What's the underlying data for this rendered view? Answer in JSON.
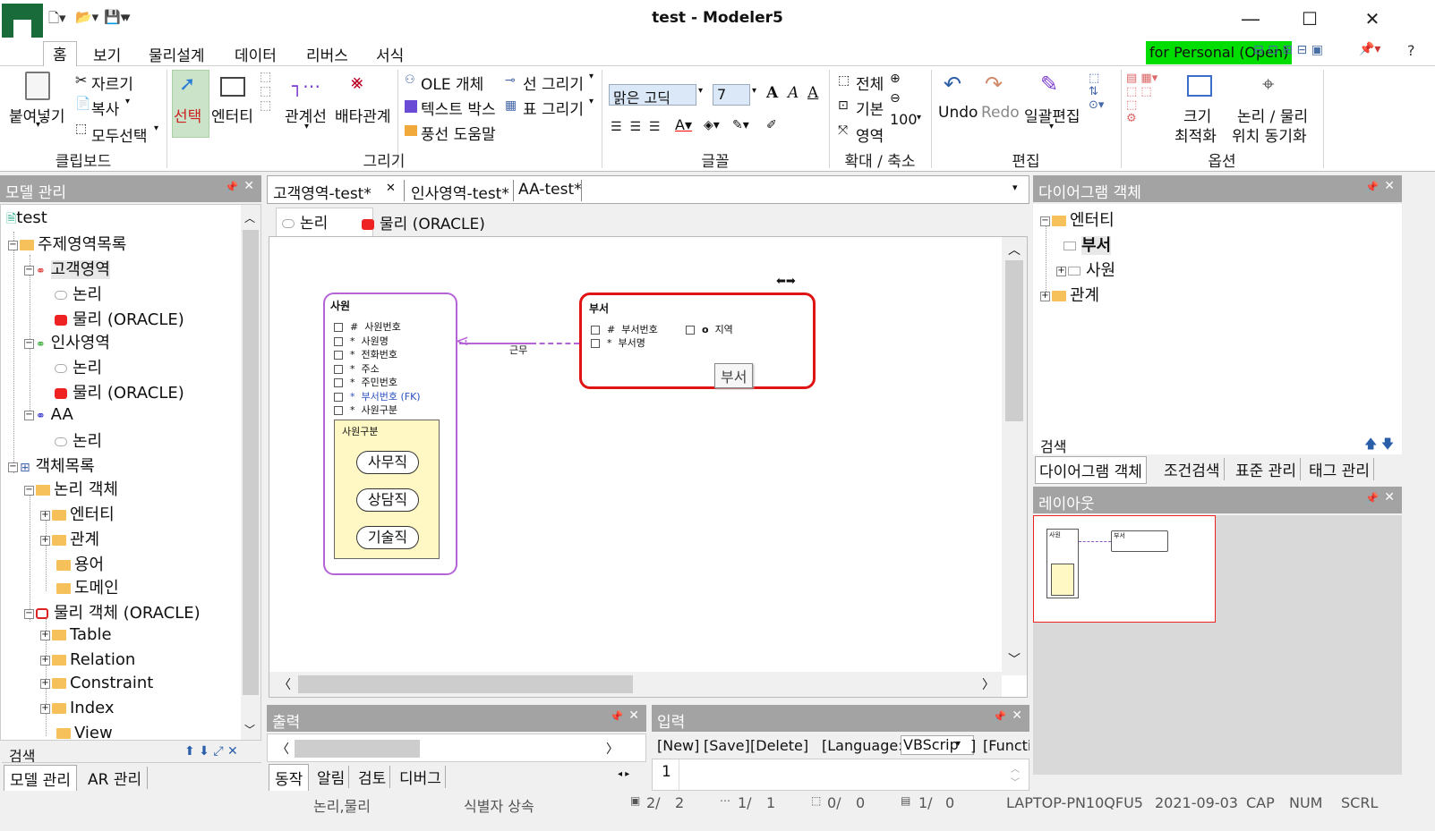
{
  "titlebar": {
    "title": "test - Modeler5",
    "minimize": "―",
    "maximize": "☐",
    "close": "✕"
  },
  "menu": {
    "items": [
      "홈",
      "보기",
      "물리설계",
      "데이터",
      "리버스",
      "서식"
    ],
    "personal": "for Personal (Open)"
  },
  "ribbon": {
    "paste": "붙여넣기",
    "cut": "자르기",
    "copy": "복사",
    "select_all": "모두선택",
    "clipboard": "클립보드",
    "select": "선택",
    "entity": "엔터티",
    "relation": "관계선",
    "exclusive": "배타관계",
    "ole": "OLE 개체",
    "textbox": "텍스트 박스",
    "balloon": "풍선 도움말",
    "line": "선 그리기",
    "table": "표 그리기",
    "draw": "그리기",
    "font_name": "맑은 고딕",
    "font_size": "7",
    "font": "글꼴",
    "all": "전체",
    "basic": "기본",
    "area": "영역",
    "zoom_value": "100",
    "zoom": "확대 / 축소",
    "undo": "Undo",
    "redo": "Redo",
    "batch": "일괄편집",
    "edit": "편집",
    "size_opt1": "크기",
    "size_opt2": "최적화",
    "lp_sync1": "논리 / 물리",
    "lp_sync2": "위치 동기화",
    "options": "옵션"
  },
  "model_panel": {
    "title": "모델 관리",
    "tree": [
      "test",
      "주제영역목록",
      "고객영역",
      "논리",
      "물리 (ORACLE)",
      "인사영역",
      "논리",
      "물리 (ORACLE)",
      "AA",
      "논리",
      "객체목록",
      "논리 객체",
      "엔터티",
      "관계",
      "용어",
      "도메인",
      "물리 객체 (ORACLE)",
      "Table",
      "Relation",
      "Constraint",
      "Index",
      "View"
    ],
    "search": "검색",
    "tabs": [
      "모델 관리",
      "AR 관리"
    ]
  },
  "doc_tabs": [
    "고객영역-test*",
    "인사영역-test*",
    "AA-test*"
  ],
  "view_tabs": [
    "논리",
    "물리 (ORACLE)"
  ],
  "diagram": {
    "entity1": {
      "name": "사원",
      "attrs": [
        {
          "key": "#",
          "name": "사원번호"
        },
        {
          "key": "*",
          "name": "사원명"
        },
        {
          "key": "*",
          "name": "전화번호"
        },
        {
          "key": "*",
          "name": "주소"
        },
        {
          "key": "*",
          "name": "주민번호"
        },
        {
          "key": "*",
          "name": "부서번호 (FK)"
        },
        {
          "key": "*",
          "name": "사원구분"
        }
      ],
      "subtype_title": "사원구분",
      "subtypes": [
        "사무직",
        "상담직",
        "기술직"
      ]
    },
    "relation_label": "근무",
    "entity2": {
      "name": "부서",
      "attrs": [
        {
          "key": "#",
          "name": "부서번호"
        },
        {
          "key": "*",
          "name": "부서명"
        }
      ],
      "extra_attr": "지역",
      "tooltip": "부서"
    }
  },
  "diagram_objects": {
    "title": "다이어그램 객체",
    "tree": [
      "엔터티",
      "부서",
      "사원",
      "관계"
    ],
    "search": "검색",
    "tabs": [
      "다이어그램 객체",
      "조건검색",
      "표준 관리",
      "태그 관리"
    ]
  },
  "layout_panel": {
    "title": "레이아웃",
    "mini_labels": [
      "사원",
      "부서"
    ]
  },
  "output_panel": {
    "title": "출력",
    "tabs": [
      "동작",
      "알림",
      "검토",
      "디버그"
    ]
  },
  "input_panel": {
    "title": "입력",
    "toolbar": [
      "[New]",
      "[Save]",
      "[Delete]",
      "[Language:",
      "VBScrip",
      "]",
      "[Functi"
    ],
    "line_no": "1"
  },
  "status": {
    "mode": "논리,물리",
    "inherit": "식별자 상속",
    "c1": "2/",
    "c1b": "2",
    "c2": "1/",
    "c2b": "1",
    "c3": "0/",
    "c3b": "0",
    "c4": "1/",
    "c4b": "0",
    "machine": "LAPTOP-PN10QFU5",
    "date": "2021-09-03",
    "cap": "CAP",
    "num": "NUM",
    "scrl": "SCRL"
  }
}
